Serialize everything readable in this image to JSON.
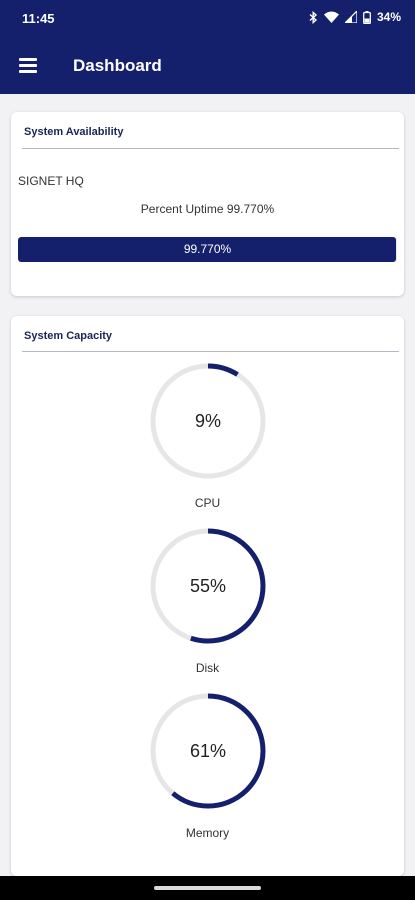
{
  "status_bar": {
    "time": "11:45",
    "battery_percent": "34%",
    "icons": [
      "bluetooth-icon",
      "wifi-icon",
      "signal-icon",
      "battery-icon"
    ]
  },
  "app_bar": {
    "title": "Dashboard",
    "menu_icon": "hamburger-menu-icon"
  },
  "availability": {
    "title": "System Availability",
    "site": "SIGNET HQ",
    "uptime_text": "Percent Uptime 99.770%",
    "uptime_fraction": 0.9977,
    "bar_label": "99.770%"
  },
  "capacity": {
    "title": "System Capacity",
    "gauges": [
      {
        "label": "CPU",
        "value_text": "9%",
        "fraction": 0.09
      },
      {
        "label": "Disk",
        "value_text": "55%",
        "fraction": 0.55
      },
      {
        "label": "Memory",
        "value_text": "61%",
        "fraction": 0.61
      }
    ]
  },
  "colors": {
    "primary": "#14206b",
    "track": "#e6e6e8",
    "background": "#f2f2f4"
  }
}
